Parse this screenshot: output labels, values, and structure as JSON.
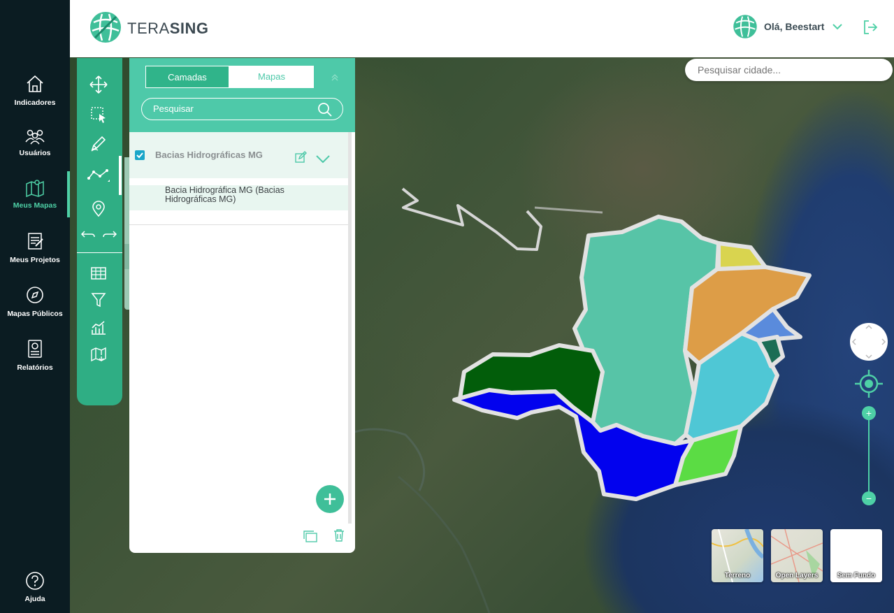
{
  "header": {
    "brand_light": "TERA",
    "brand_bold": "SING",
    "greeting": "Olá, Beestart"
  },
  "sidebar": {
    "items": [
      {
        "label": "Indicadores",
        "icon": "home-icon"
      },
      {
        "label": "Usuários",
        "icon": "users-icon"
      },
      {
        "label": "Meus Mapas",
        "icon": "map-pin-icon",
        "active": true
      },
      {
        "label": "Meus Projetos",
        "icon": "projects-icon"
      },
      {
        "label": "Mapas Públicos",
        "icon": "compass-icon"
      },
      {
        "label": "Relatórios",
        "icon": "report-icon"
      }
    ],
    "help": "Ajuda"
  },
  "map": {
    "search_placeholder": "Pesquisar cidade..."
  },
  "panel": {
    "tabs": [
      "Camadas",
      "Mapas"
    ],
    "active_tab": "Mapas",
    "search_placeholder": "Pesquisar",
    "layer_group": "Bacias Hidrográficas MG",
    "layer_item": "Bacia Hidrográfica MG (Bacias Hidrográficas MG)"
  },
  "basemaps": [
    "Terreno",
    "Open Layers",
    "Sem Fundo"
  ],
  "colors": {
    "accent": "#4ed0a6",
    "toolbar": "#2fae84",
    "sidebar": "#0b1c22"
  }
}
